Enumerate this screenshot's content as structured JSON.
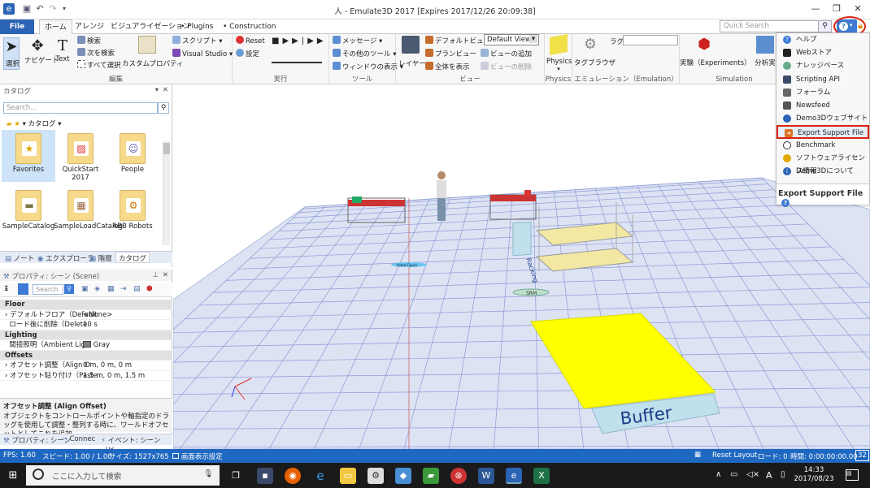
{
  "window": {
    "title": "人 - Emulate3D 2017 [Expires 2017/12/26 20:09:38]"
  },
  "tabs": {
    "file": "File",
    "home": "ホーム",
    "arrange": "アレンジ",
    "visualization": "ビジュアライゼーション",
    "plugins": "• Plugins",
    "construction": "• Construction"
  },
  "quick_search": {
    "placeholder": "Quick Search"
  },
  "ribbon": {
    "select": "選択",
    "navigate": "ナビゲート",
    "text": "Text",
    "search": "検索",
    "search_next": "次を検索",
    "select_all": "すべて選択",
    "custom_property": "カスタムプロパティ",
    "script": "スクリプト",
    "visual_studio": "Visual Studio",
    "group_edit": "編集",
    "reset": "Reset",
    "settings": "設定",
    "group_run": "実行",
    "message": "メッセージ",
    "other_tools": "その他のツール",
    "window_display": "ウィンドウの表示",
    "group_tools": "ツール",
    "layer": "レイヤー",
    "default_view": "デフォルトビュー",
    "plan_view": "プランビュー",
    "show_all": "全体を表示",
    "add_view": "ビューの追加",
    "delete_view": "ビューの削除",
    "view_select": "Default View",
    "group_view": "ビュー",
    "physics": "Physics",
    "group_physics": "Physics",
    "tag_browser": "タグブラウザ",
    "lag": "ラグ",
    "group_emulation": "エミュレーション（Emulation）",
    "experiments": "実験（Experiments）",
    "analysis": "分析実",
    "group_simulation": "Simulation"
  },
  "catalog": {
    "title": "カタログ",
    "search_placeholder": "Search...",
    "breadcrumb": "カタログ",
    "items": [
      "Favorites",
      "QuickStart 2017",
      "People",
      "SampleCatalog",
      "SampleLoadCatalog",
      "ABB Robots"
    ],
    "tabs": [
      "ノート",
      "エクスプローラ",
      "階層",
      "カタログ"
    ]
  },
  "properties": {
    "title": "プロパティ: シーン (Scene)",
    "search_placeholder": "Search",
    "rows": [
      {
        "type": "section",
        "label": "Floor"
      },
      {
        "type": "row",
        "label": "デフォルトフロア（Default",
        "value": "<None>"
      },
      {
        "type": "row",
        "label": "ロード後に削除（Delete",
        "value": "10 s"
      },
      {
        "type": "section",
        "label": "Lighting"
      },
      {
        "type": "row",
        "label": "間接照明（Ambient Lig",
        "value": "Gray"
      },
      {
        "type": "section",
        "label": "Offsets"
      },
      {
        "type": "row",
        "label": "オフセット調整（Align O",
        "value": "0 m, 0 m, 0 m"
      },
      {
        "type": "row",
        "label": "オフセット貼り付け（Paste",
        "value": "1.5 m, 0 m, 1.5 m"
      }
    ],
    "desc_title": "オフセット調整 (Align Offset)",
    "desc_text": "オブジェクトをコントロールポイントや軸指定のドラッグを使用して調整・整列する時に、ワールドオフセットとしてこれを追加...",
    "tabs": [
      "プロパティ: シーン",
      "Connec",
      "イベント: シーン（ビ"
    ]
  },
  "scene": {
    "buffer_label": "Buffer",
    "racking_label": "Racking",
    "srm_label": "SRM",
    "small_label": "Robot Figure"
  },
  "status": {
    "fps": "FPS: 1.60",
    "speed": "スピード: 1.00 / 1.00",
    "size": "サイズ: 1527x765",
    "display": "画面表示設定",
    "reset_layout": "Reset Layout",
    "load": "ロード: 0",
    "time": "時間: 0:00:00:00.00",
    "page": "32"
  },
  "taskbar": {
    "search_placeholder": "ここに入力して検索",
    "time": "14:33",
    "date": "2017/08/23",
    "ime": "A"
  },
  "help_menu": {
    "items": [
      "ヘルプ",
      "Webストア",
      "ナレッジベース",
      "Scripting API",
      "フォーラム",
      "Newsfeed",
      "Demo3Dウェブサイト",
      "Export Support File",
      "Benchmark",
      "ソフトウェアライセンス情報",
      "Demo3Dについて"
    ],
    "tooltip": "Export Support File"
  }
}
